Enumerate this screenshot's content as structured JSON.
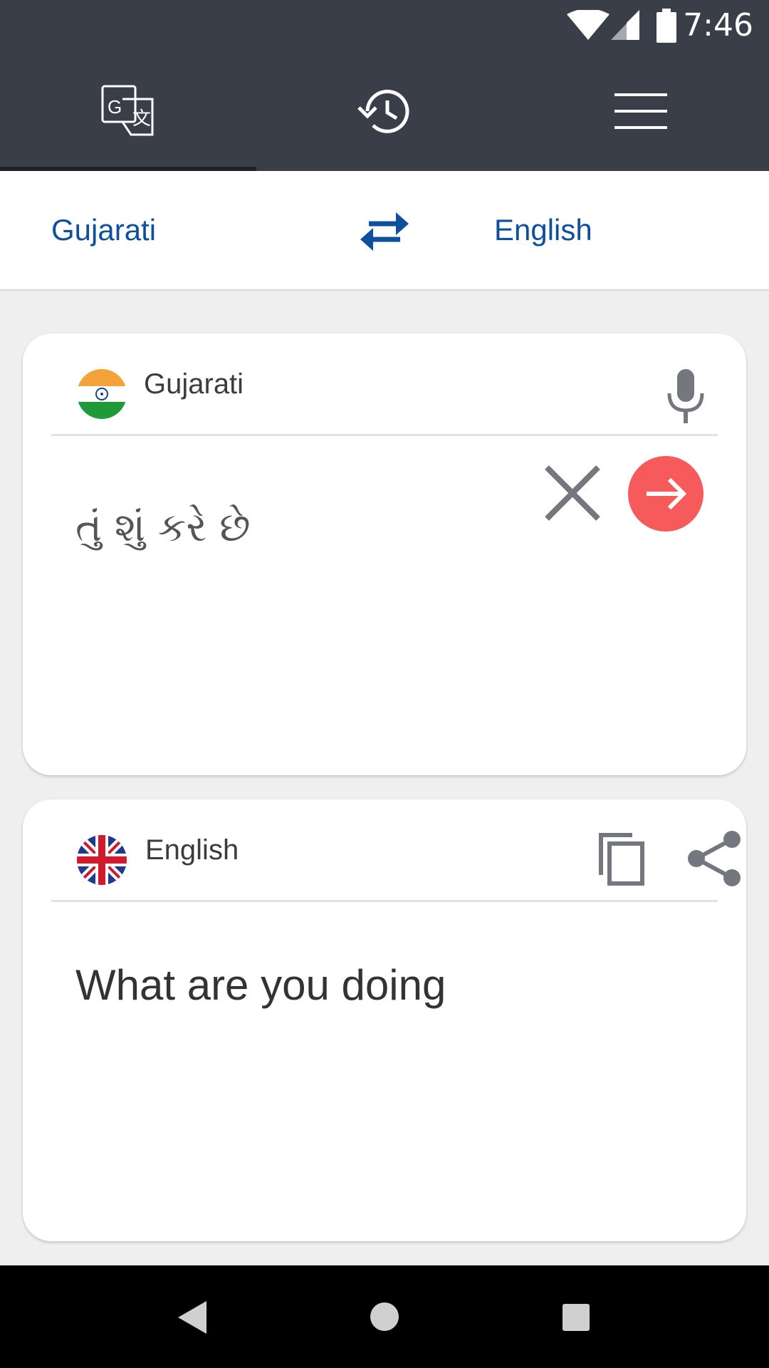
{
  "status_bar": {
    "time": "7:46"
  },
  "tabs": [
    {
      "icon": "translate-icon"
    },
    {
      "icon": "history-icon"
    },
    {
      "icon": "menu-icon"
    }
  ],
  "language_bar": {
    "source_language": "Gujarati",
    "target_language": "English",
    "swap_icon": "swap-arrows-icon"
  },
  "input_card": {
    "language_label": "Gujarati",
    "text": "તું શું કરે છે",
    "flag": "india-flag-icon",
    "mic_icon": "microphone-icon",
    "clear_icon": "close-icon",
    "translate_icon": "arrow-right-icon"
  },
  "output_card": {
    "language_label": "English",
    "text": "What are you doing",
    "flag": "uk-flag-icon",
    "copy_icon": "copy-icon",
    "share_icon": "share-icon"
  },
  "colors": {
    "toolbar": "#393e48",
    "accent_blue": "#0e4f9e",
    "translate_button": "#f65a5a",
    "icon_gray": "#74777e"
  }
}
